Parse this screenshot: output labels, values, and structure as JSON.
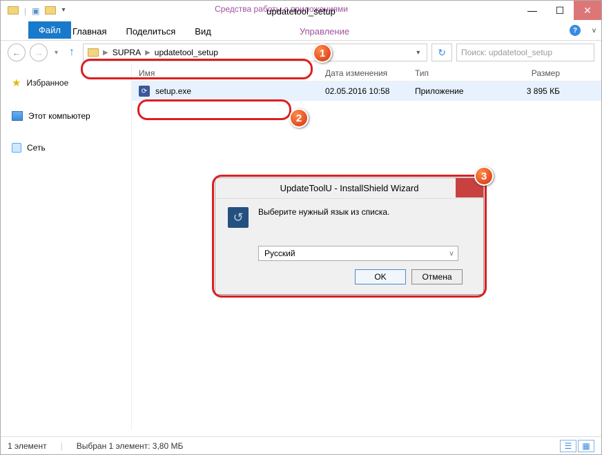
{
  "title": "updatetool_setup",
  "context_tab_title": "Средства работы с приложениями",
  "ribbon": {
    "file": "Файл",
    "home": "Главная",
    "share": "Поделиться",
    "view": "Вид",
    "manage": "Управление"
  },
  "breadcrumb": {
    "parent": "SUPRA",
    "current": "updatetool_setup"
  },
  "search_placeholder": "Поиск: updatetool_setup",
  "sidebar": {
    "favorites": "Избранное",
    "this_pc": "Этот компьютер",
    "network": "Сеть"
  },
  "columns": {
    "name": "Имя",
    "date": "Дата изменения",
    "type": "Тип",
    "size": "Размер"
  },
  "file": {
    "name": "setup.exe",
    "date": "02.05.2016 10:58",
    "type": "Приложение",
    "size": "3 895 КБ"
  },
  "status": {
    "count": "1 элемент",
    "selection": "Выбран 1 элемент: 3,80 МБ"
  },
  "dialog": {
    "title": "UpdateToolU - InstallShield Wizard",
    "message": "Выберите нужный язык из списка.",
    "language": "Русский",
    "ok": "OK",
    "cancel": "Отмена"
  },
  "badges": {
    "one": "1",
    "two": "2",
    "three": "3"
  }
}
